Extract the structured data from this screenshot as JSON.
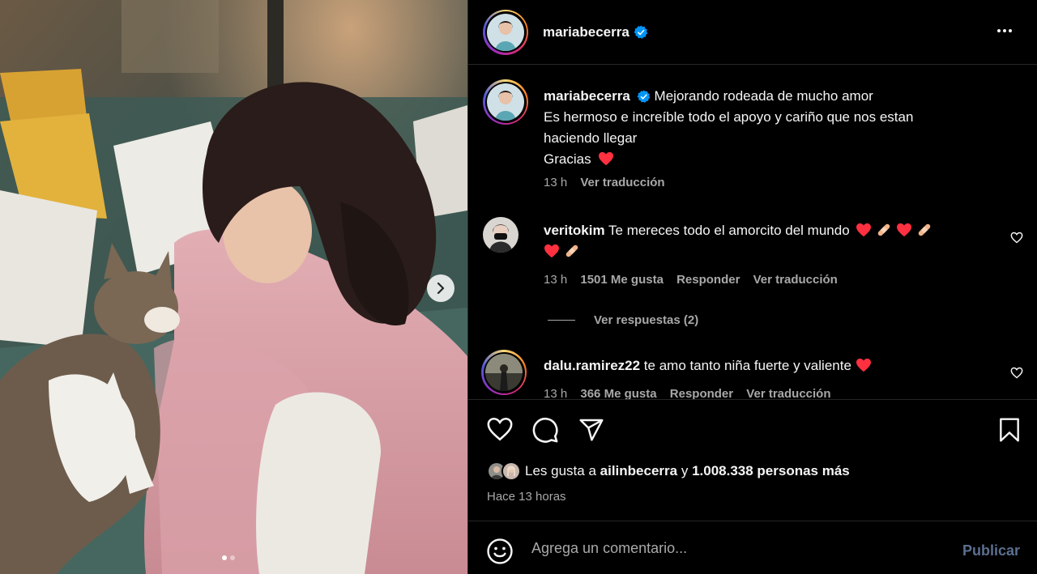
{
  "post": {
    "username": "mariabecerra",
    "verified": true
  },
  "caption": {
    "username": "mariabecerra",
    "lines": [
      "Mejorando rodeada de mucho amor",
      "Es hermoso e increíble todo el apoyo y cariño que nos estan haciendo llegar",
      "Gracias"
    ],
    "time": "13 h",
    "translate": "Ver traducción"
  },
  "comments": [
    {
      "username": "veritokim",
      "text": "Te mereces todo el amorcito del mundo",
      "emoji_suffix": "❤️🩹❤️🩹❤️🩹",
      "time": "13 h",
      "likes": "1501 Me gusta",
      "reply": "Responder",
      "translate": "Ver traducción",
      "view_replies": "Ver respuestas (2)"
    },
    {
      "username": "dalu.ramirez22",
      "text": "te amo tanto niña fuerte y valiente",
      "emoji_suffix": "❤️",
      "time": "13 h",
      "likes": "366 Me gusta",
      "reply": "Responder",
      "translate": "Ver traducción"
    }
  ],
  "likes": {
    "prefix": "Les gusta a",
    "first_user": "ailinbecerra",
    "joiner": "y",
    "others": "1.008.338 personas más"
  },
  "time_ago": "Hace 13 horas",
  "composer": {
    "placeholder": "Agrega un comentario...",
    "publish": "Publicar"
  },
  "carousel": {
    "slides": 2,
    "current": 1
  },
  "colors": {
    "background": "#000000",
    "text": "#f5f5f5",
    "muted": "#a8a8a8",
    "verified": "#0095f6",
    "heart": "#ff3040",
    "publish": "#5b6f8f"
  },
  "icons": [
    "more-options-icon",
    "verified-badge-icon",
    "heart-icon",
    "comment-icon",
    "share-icon",
    "bookmark-icon",
    "emoji-icon",
    "chevron-right-icon"
  ]
}
